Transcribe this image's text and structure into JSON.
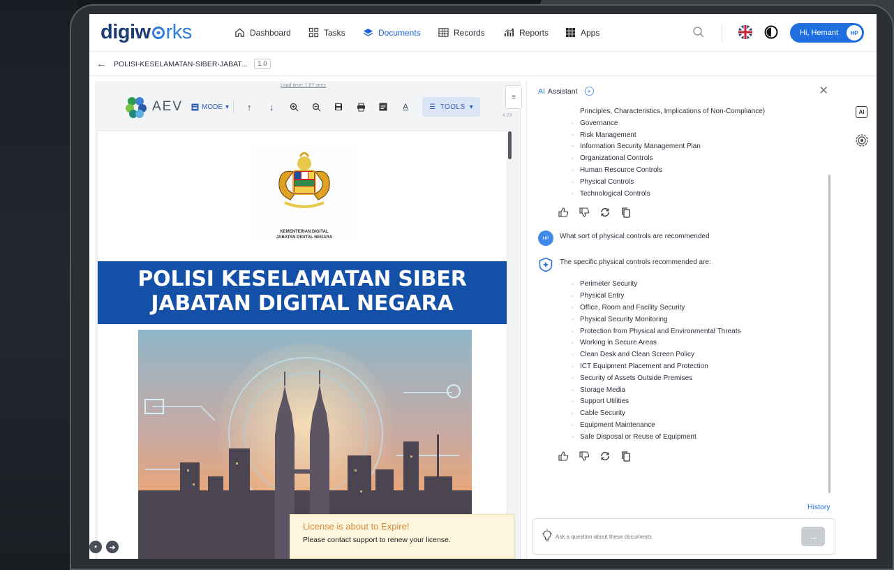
{
  "app": {
    "logo_part1": "digiw",
    "logo_part2": "rks"
  },
  "nav": {
    "dashboard": "Dashboard",
    "tasks": "Tasks",
    "documents": "Documents",
    "records": "Records",
    "reports": "Reports",
    "apps": "Apps",
    "user_greeting": "Hi, Hemant",
    "user_initials": "HP"
  },
  "breadcrumb": {
    "doc_title": "POLISI-KESELAMATAN-SIBER-JABAT...",
    "version": "1.0"
  },
  "viewer": {
    "load_time": "Load time: 1.07 secs",
    "brand": "AEV",
    "mode_label": "MODE",
    "tools_label": "TOOLS",
    "side_number": "4.23",
    "doc": {
      "emblem_caption_1": "KEMENTERIAN DIGITAL",
      "emblem_caption_2": "JABATAN DIGITAL NEGARA",
      "title_line1": "POLISI KESELAMATAN SIBER",
      "title_line2": "JABATAN DIGITAL NEGARA"
    }
  },
  "license": {
    "title": "License is about to Expire!",
    "message": "Please contact support to renew your license."
  },
  "ai_assistant": {
    "title_prefix": "AI",
    "title_rest": "Assistant",
    "previous_continuation": "Principles, Characteristics, Implications of Non-Compliance)",
    "previous_items": [
      "Governance",
      "Risk Management",
      "Information Security Management Plan",
      "Organizational Controls",
      "Human Resource Controls",
      "Physical Controls",
      "Technological Controls"
    ],
    "user_question": "What sort of physical controls are recommended",
    "user_initials": "HP",
    "answer_intro": "The specific physical controls recommended are:",
    "answer_items": [
      "Perimeter Security",
      "Physical Entry",
      "Office, Room and Facility Security",
      "Physical Security Monitoring",
      "Protection from Physical and Environmental Threats",
      "Working in Secure Areas",
      "Clean Desk and Clean Screen Policy",
      "ICT Equipment Placement and Protection",
      "Security of Assets Outside Premises",
      "Storage Media",
      "Support Utilities",
      "Cable Security",
      "Equipment Maintenance",
      "Safe Disposal or Reuse of Equipment"
    ],
    "history_label": "History",
    "input_placeholder": "Ask a question about these documents"
  },
  "colors": {
    "accent": "#1f6fe0",
    "brand_dark": "#1d3c74",
    "banner": "#1450a8",
    "warning_text": "#d4893b"
  }
}
